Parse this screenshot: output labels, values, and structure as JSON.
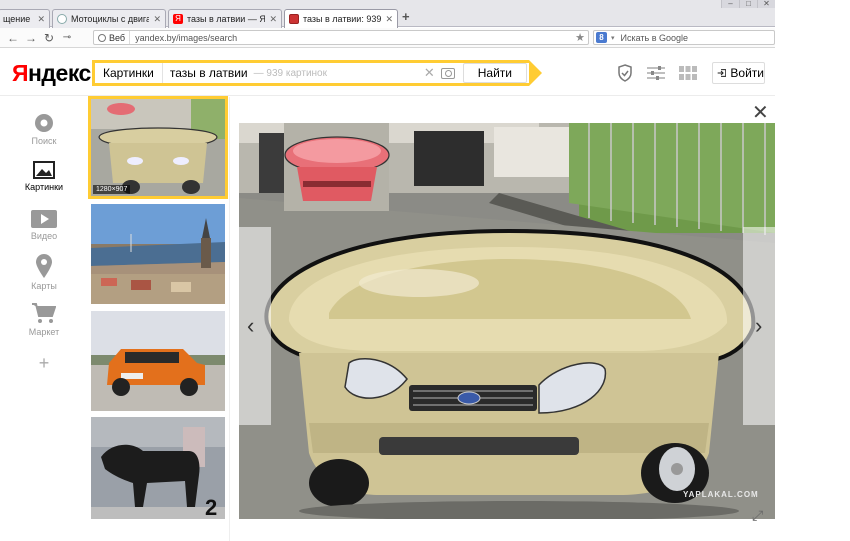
{
  "browser": {
    "tabs": [
      {
        "title": "щение в...",
        "favicon_color": "#4a7ad0",
        "active": false
      },
      {
        "title": "Мотоциклы с двигате...",
        "favicon_color": "#6b8fb7",
        "active": false
      },
      {
        "title": "тазы в латвии — Янде...",
        "favicon_color": "#f00000",
        "favicon_text": "Я",
        "active": false
      },
      {
        "title": "тазы в латвии: 939 изо...",
        "favicon_color": "#cc3333",
        "active": true
      }
    ],
    "tab_close": "✕",
    "new_tab": "+",
    "url_chip": "Веб",
    "url": "yandex.by/images/search",
    "search_engine_placeholder": "Искать в Google",
    "window_controls": [
      "–",
      "□",
      "✕"
    ]
  },
  "header": {
    "logo_first": "Я",
    "logo_rest": "ндекс",
    "service": "Картинки",
    "query": "тазы в латвии",
    "count": "— 939 картинок",
    "search_button": "Найти",
    "login_label": "Войти",
    "icons": [
      "shield-icon",
      "settings-sliders-icon",
      "grid-icon",
      "login-icon",
      "clear-icon",
      "camera-icon"
    ]
  },
  "leftnav": {
    "items": [
      {
        "label": "Поиск",
        "icon": "search-circle-icon",
        "active": false
      },
      {
        "label": "Картинки",
        "icon": "images-icon",
        "active": true
      },
      {
        "label": "Видео",
        "icon": "video-icon",
        "active": false
      },
      {
        "label": "Карты",
        "icon": "map-pin-icon",
        "active": false
      },
      {
        "label": "Маркет",
        "icon": "cart-icon",
        "active": false
      }
    ],
    "more": "+"
  },
  "thumbnails": [
    {
      "dims": "1280×907",
      "selected": true,
      "subject": "car-basin"
    },
    {
      "subject": "riga-panorama"
    },
    {
      "subject": "orange-lada"
    },
    {
      "subject": "black-dog",
      "corner_digit": "2"
    }
  ],
  "viewer": {
    "close": "✕",
    "prev": "‹",
    "next": "›",
    "expand": "⤢",
    "watermark": "YAPLAKAL.COM"
  }
}
